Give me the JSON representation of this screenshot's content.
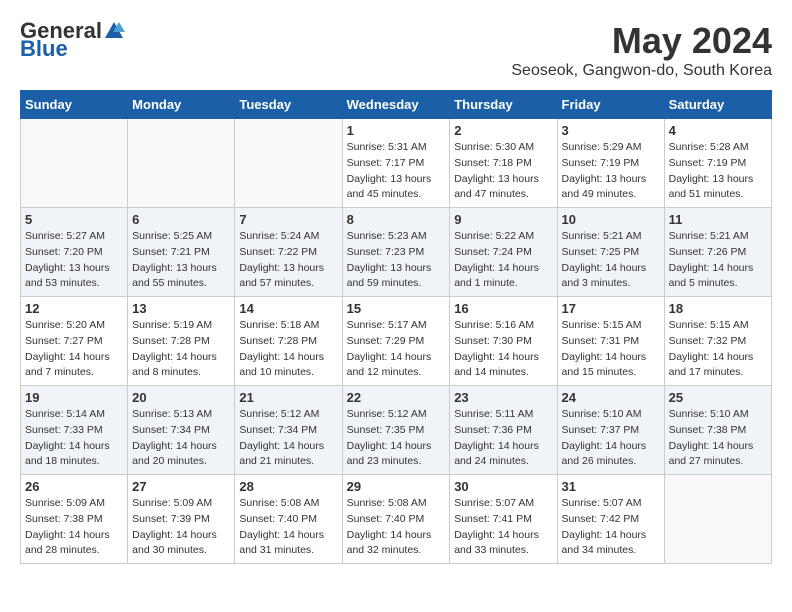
{
  "header": {
    "logo_general": "General",
    "logo_blue": "Blue",
    "month_title": "May 2024",
    "location": "Seoseok, Gangwon-do, South Korea"
  },
  "weekdays": [
    "Sunday",
    "Monday",
    "Tuesday",
    "Wednesday",
    "Thursday",
    "Friday",
    "Saturday"
  ],
  "weeks": [
    {
      "shaded": false,
      "days": [
        {
          "num": "",
          "info": ""
        },
        {
          "num": "",
          "info": ""
        },
        {
          "num": "",
          "info": ""
        },
        {
          "num": "1",
          "info": "Sunrise: 5:31 AM\nSunset: 7:17 PM\nDaylight: 13 hours\nand 45 minutes."
        },
        {
          "num": "2",
          "info": "Sunrise: 5:30 AM\nSunset: 7:18 PM\nDaylight: 13 hours\nand 47 minutes."
        },
        {
          "num": "3",
          "info": "Sunrise: 5:29 AM\nSunset: 7:19 PM\nDaylight: 13 hours\nand 49 minutes."
        },
        {
          "num": "4",
          "info": "Sunrise: 5:28 AM\nSunset: 7:19 PM\nDaylight: 13 hours\nand 51 minutes."
        }
      ]
    },
    {
      "shaded": true,
      "days": [
        {
          "num": "5",
          "info": "Sunrise: 5:27 AM\nSunset: 7:20 PM\nDaylight: 13 hours\nand 53 minutes."
        },
        {
          "num": "6",
          "info": "Sunrise: 5:25 AM\nSunset: 7:21 PM\nDaylight: 13 hours\nand 55 minutes."
        },
        {
          "num": "7",
          "info": "Sunrise: 5:24 AM\nSunset: 7:22 PM\nDaylight: 13 hours\nand 57 minutes."
        },
        {
          "num": "8",
          "info": "Sunrise: 5:23 AM\nSunset: 7:23 PM\nDaylight: 13 hours\nand 59 minutes."
        },
        {
          "num": "9",
          "info": "Sunrise: 5:22 AM\nSunset: 7:24 PM\nDaylight: 14 hours\nand 1 minute."
        },
        {
          "num": "10",
          "info": "Sunrise: 5:21 AM\nSunset: 7:25 PM\nDaylight: 14 hours\nand 3 minutes."
        },
        {
          "num": "11",
          "info": "Sunrise: 5:21 AM\nSunset: 7:26 PM\nDaylight: 14 hours\nand 5 minutes."
        }
      ]
    },
    {
      "shaded": false,
      "days": [
        {
          "num": "12",
          "info": "Sunrise: 5:20 AM\nSunset: 7:27 PM\nDaylight: 14 hours\nand 7 minutes."
        },
        {
          "num": "13",
          "info": "Sunrise: 5:19 AM\nSunset: 7:28 PM\nDaylight: 14 hours\nand 8 minutes."
        },
        {
          "num": "14",
          "info": "Sunrise: 5:18 AM\nSunset: 7:28 PM\nDaylight: 14 hours\nand 10 minutes."
        },
        {
          "num": "15",
          "info": "Sunrise: 5:17 AM\nSunset: 7:29 PM\nDaylight: 14 hours\nand 12 minutes."
        },
        {
          "num": "16",
          "info": "Sunrise: 5:16 AM\nSunset: 7:30 PM\nDaylight: 14 hours\nand 14 minutes."
        },
        {
          "num": "17",
          "info": "Sunrise: 5:15 AM\nSunset: 7:31 PM\nDaylight: 14 hours\nand 15 minutes."
        },
        {
          "num": "18",
          "info": "Sunrise: 5:15 AM\nSunset: 7:32 PM\nDaylight: 14 hours\nand 17 minutes."
        }
      ]
    },
    {
      "shaded": true,
      "days": [
        {
          "num": "19",
          "info": "Sunrise: 5:14 AM\nSunset: 7:33 PM\nDaylight: 14 hours\nand 18 minutes."
        },
        {
          "num": "20",
          "info": "Sunrise: 5:13 AM\nSunset: 7:34 PM\nDaylight: 14 hours\nand 20 minutes."
        },
        {
          "num": "21",
          "info": "Sunrise: 5:12 AM\nSunset: 7:34 PM\nDaylight: 14 hours\nand 21 minutes."
        },
        {
          "num": "22",
          "info": "Sunrise: 5:12 AM\nSunset: 7:35 PM\nDaylight: 14 hours\nand 23 minutes."
        },
        {
          "num": "23",
          "info": "Sunrise: 5:11 AM\nSunset: 7:36 PM\nDaylight: 14 hours\nand 24 minutes."
        },
        {
          "num": "24",
          "info": "Sunrise: 5:10 AM\nSunset: 7:37 PM\nDaylight: 14 hours\nand 26 minutes."
        },
        {
          "num": "25",
          "info": "Sunrise: 5:10 AM\nSunset: 7:38 PM\nDaylight: 14 hours\nand 27 minutes."
        }
      ]
    },
    {
      "shaded": false,
      "days": [
        {
          "num": "26",
          "info": "Sunrise: 5:09 AM\nSunset: 7:38 PM\nDaylight: 14 hours\nand 28 minutes."
        },
        {
          "num": "27",
          "info": "Sunrise: 5:09 AM\nSunset: 7:39 PM\nDaylight: 14 hours\nand 30 minutes."
        },
        {
          "num": "28",
          "info": "Sunrise: 5:08 AM\nSunset: 7:40 PM\nDaylight: 14 hours\nand 31 minutes."
        },
        {
          "num": "29",
          "info": "Sunrise: 5:08 AM\nSunset: 7:40 PM\nDaylight: 14 hours\nand 32 minutes."
        },
        {
          "num": "30",
          "info": "Sunrise: 5:07 AM\nSunset: 7:41 PM\nDaylight: 14 hours\nand 33 minutes."
        },
        {
          "num": "31",
          "info": "Sunrise: 5:07 AM\nSunset: 7:42 PM\nDaylight: 14 hours\nand 34 minutes."
        },
        {
          "num": "",
          "info": ""
        }
      ]
    }
  ]
}
